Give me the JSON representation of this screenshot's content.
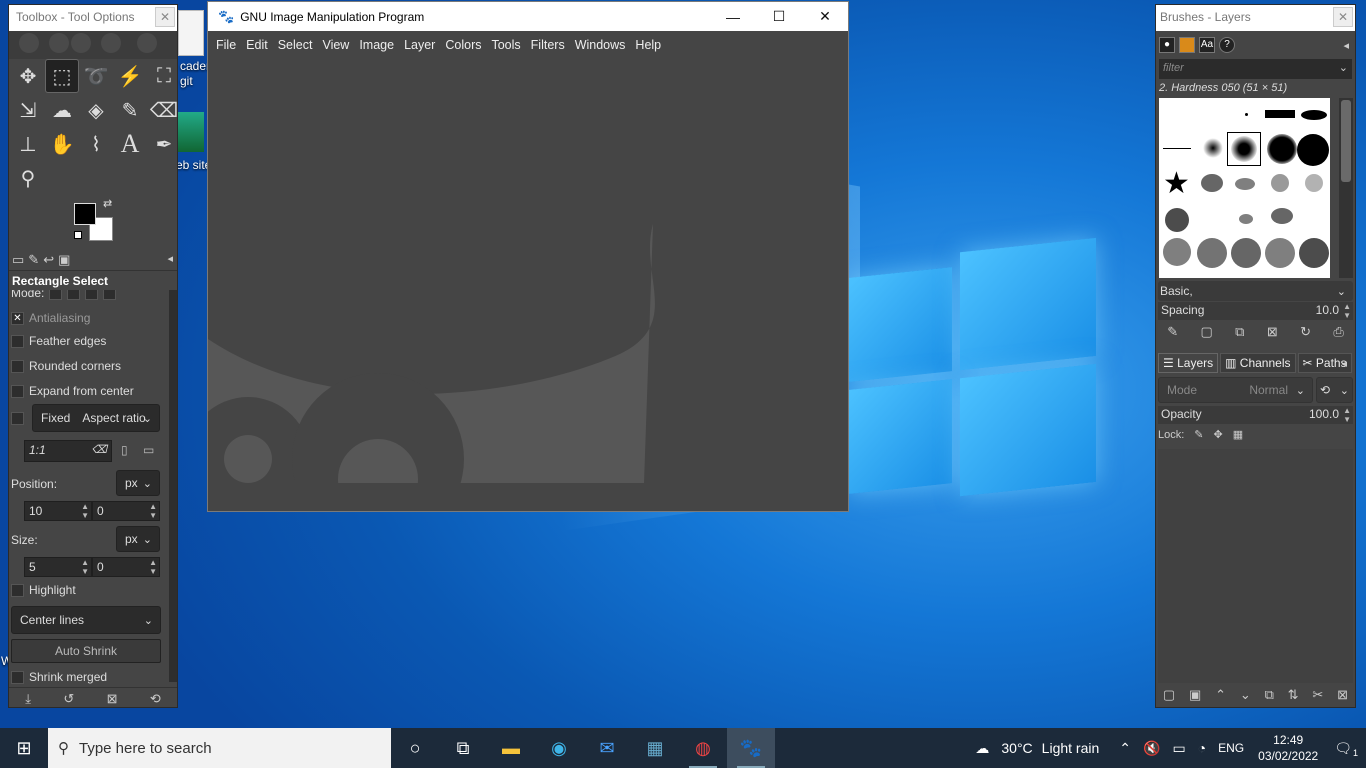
{
  "desktop": {
    "icon_labels": [
      "cader",
      "git",
      "eb site"
    ],
    "cut_letter": "W"
  },
  "toolbox": {
    "title": "Toolbox - Tool Options",
    "tool_options_title": "Rectangle Select",
    "mode_label": "Mode:",
    "antialiasing": "Antialiasing",
    "feather": "Feather edges",
    "rounded": "Rounded corners",
    "expand": "Expand from center",
    "fixed": "Fixed",
    "fixed_mode": "Aspect ratio",
    "ratio": "1:1",
    "position_label": "Position:",
    "position_unit": "px",
    "pos_x": "10",
    "pos_y": "0",
    "size_label": "Size:",
    "size_unit": "px",
    "size_w": "5",
    "size_h": "0",
    "highlight": "Highlight",
    "guides": "Center lines",
    "auto_shrink": "Auto Shrink",
    "shrink_merged": "Shrink merged"
  },
  "main": {
    "title": "GNU Image Manipulation Program",
    "menus": [
      "File",
      "Edit",
      "Select",
      "View",
      "Image",
      "Layer",
      "Colors",
      "Tools",
      "Filters",
      "Windows",
      "Help"
    ]
  },
  "dock": {
    "title": "Brushes - Layers",
    "filter_placeholder": "filter",
    "brush_name": "2. Hardness 050 (51 × 51)",
    "tag": "Basic,",
    "spacing_label": "Spacing",
    "spacing_value": "10.0",
    "tabs": [
      "Layers",
      "Channels",
      "Paths"
    ],
    "mode_label": "Mode",
    "mode_value": "Normal",
    "opacity_label": "Opacity",
    "opacity_value": "100.0",
    "lock_label": "Lock:"
  },
  "taskbar": {
    "search_placeholder": "Type here to search",
    "weather_temp": "30°C",
    "weather_desc": "Light rain",
    "lang": "ENG",
    "time": "12:49",
    "date": "03/02/2022",
    "notifications": "1"
  }
}
